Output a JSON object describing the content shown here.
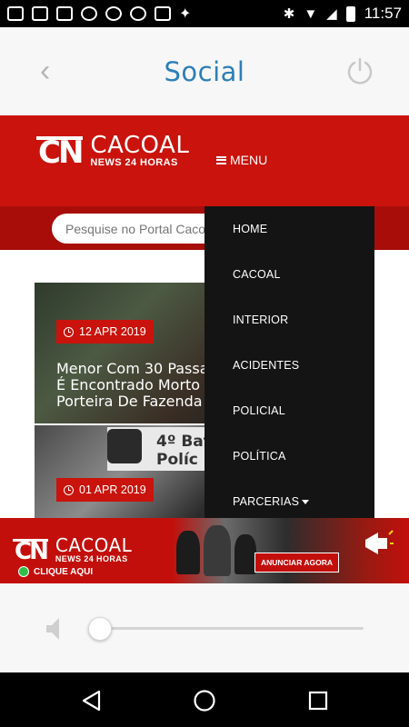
{
  "status_bar": {
    "time": "11:57",
    "icons": [
      "mail-icon",
      "message-icon",
      "facebook-icon",
      "b-icon",
      "instagram-icon",
      "instagram-icon",
      "gmail-icon",
      "butterfly-icon",
      "bluetooth-icon",
      "wifi-icon",
      "signal-icon",
      "battery-icon"
    ]
  },
  "header": {
    "title": "Social",
    "back_icon": "chevron-left-icon",
    "power_icon": "power-icon"
  },
  "site": {
    "logo_mark": "CN",
    "logo_name": "CACOAL",
    "logo_tagline": "NEWS 24 HORAS",
    "menu_label": "MENU",
    "search_placeholder": "Pesquise no Portal Cacoal"
  },
  "articles": [
    {
      "date": "12 APR 2019",
      "title": "Menor Com 30 Passa\nÉ Encontrado Morto\nPorteira De Fazenda"
    },
    {
      "date": "01 APR 2019",
      "sign_text": "4º Bat\nPolíc"
    }
  ],
  "menu": {
    "items": [
      "HOME",
      "CACOAL",
      "INTERIOR",
      "ACIDENTES",
      "POLICIAL",
      "POLÍTICA",
      "PARCERIAS"
    ]
  },
  "ad": {
    "logo_mark": "CN",
    "logo_name": "CACOAL",
    "logo_tagline": "NEWS 24 HORAS",
    "whatsapp_label": "CLIQUE AQUI",
    "cta": "ANUNCIAR AGORA"
  },
  "player": {
    "volume_level": 0.0
  },
  "colors": {
    "brand_red": "#c9130c",
    "title_blue": "#2d7fb8",
    "menu_bg": "#141414"
  }
}
